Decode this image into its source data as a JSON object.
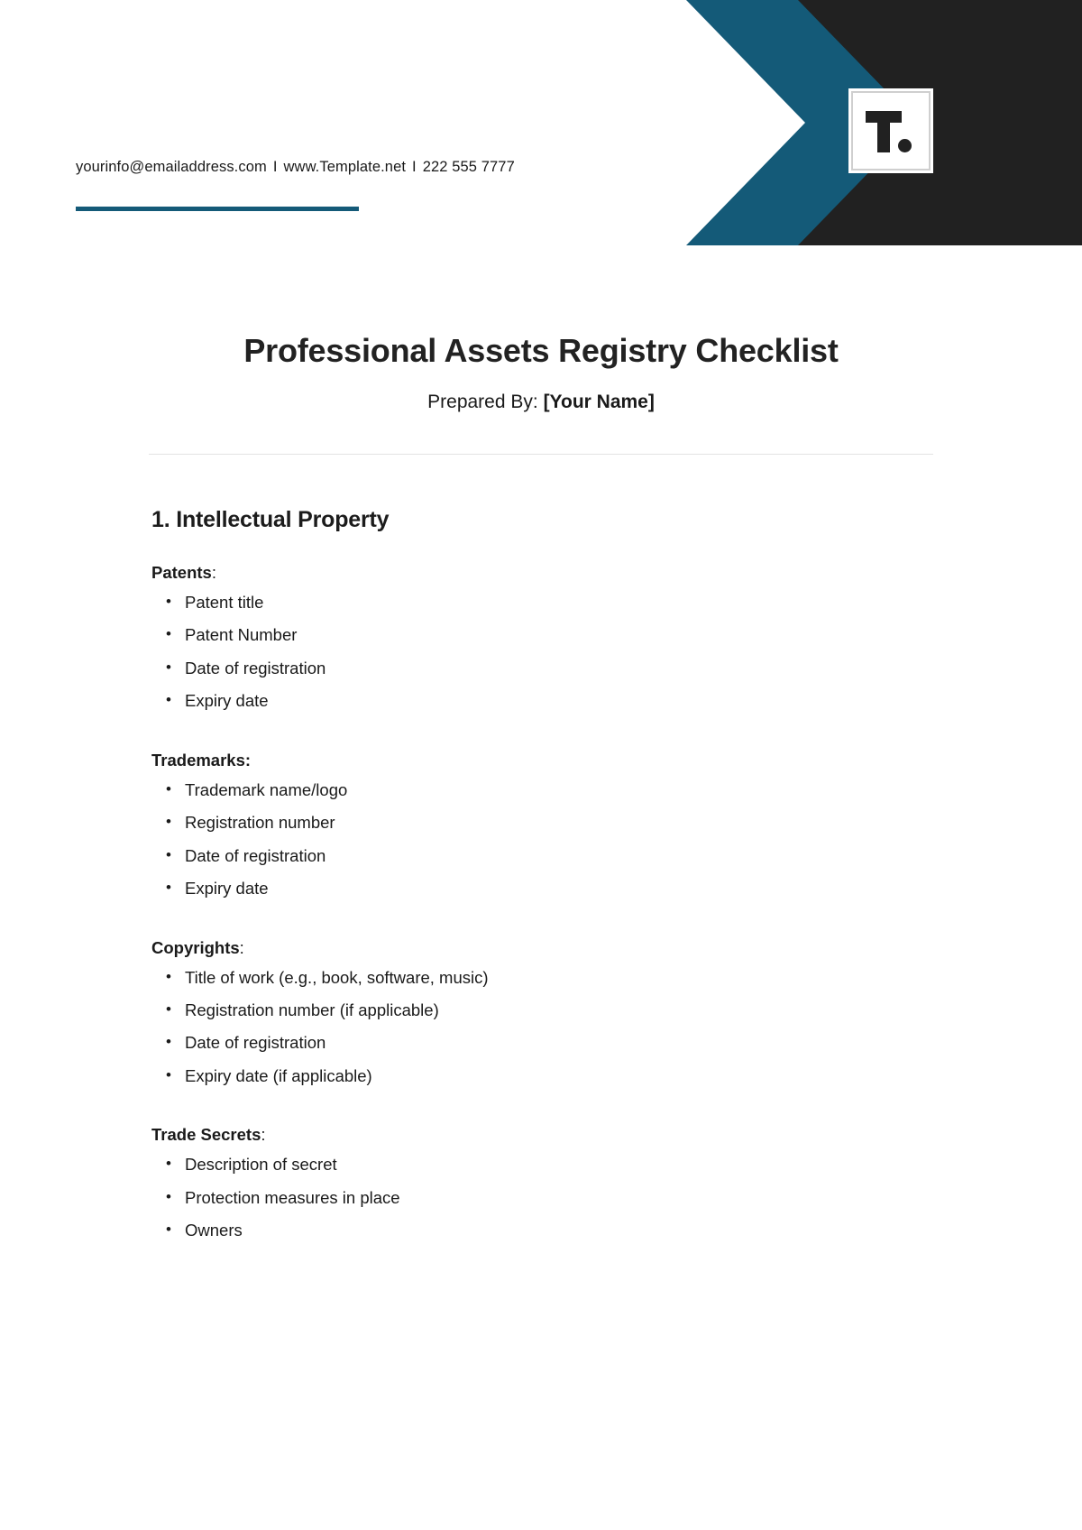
{
  "header": {
    "contact": {
      "email": "yourinfo@emailaddress.com",
      "separator": "I",
      "website": "www.Template.net",
      "phone": "222 555 7777"
    },
    "logo": {
      "name": "template-net-logo",
      "letter": "T",
      "dot": "."
    },
    "colors": {
      "teal_light": "#2f93a5",
      "teal_dark": "#145a78",
      "charcoal": "#212121",
      "rule": "#145a78"
    }
  },
  "document": {
    "title": "Professional Assets Registry Checklist",
    "prepared_by_label": "Prepared By:",
    "prepared_by_value": "[Your Name]"
  },
  "sections": [
    {
      "heading": "1. Intellectual Property",
      "groups": [
        {
          "label": "Patents",
          "colon": ":",
          "colon_bold": false,
          "items": [
            "Patent title",
            "Patent Number",
            "Date of registration",
            "Expiry date"
          ]
        },
        {
          "label": "Trademarks",
          "colon": ":",
          "colon_bold": true,
          "items": [
            "Trademark name/logo",
            "Registration number",
            "Date of registration",
            "Expiry date"
          ]
        },
        {
          "label": "Copyrights",
          "colon": ":",
          "colon_bold": false,
          "items": [
            "Title of work (e.g., book, software, music)",
            "Registration number (if applicable)",
            "Date of registration",
            "Expiry date (if applicable)"
          ]
        },
        {
          "label": "Trade Secrets",
          "colon": ":",
          "colon_bold": false,
          "items": [
            "Description of secret",
            "Protection measures in place",
            "Owners"
          ]
        }
      ]
    }
  ]
}
